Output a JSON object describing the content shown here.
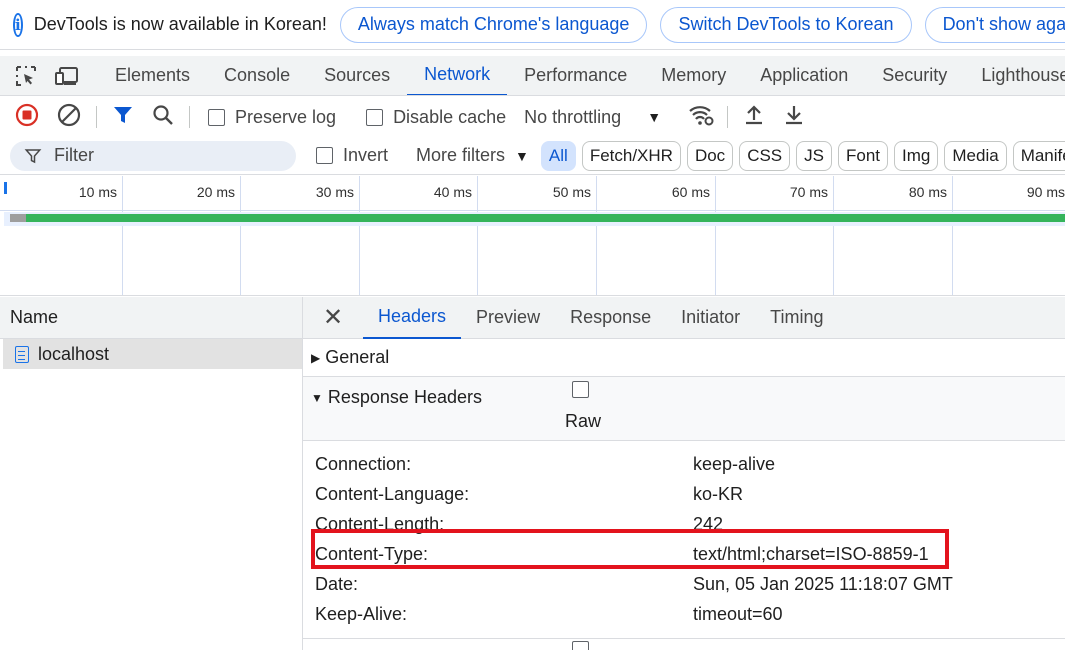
{
  "infobar": {
    "message": "DevTools is now available in Korean!",
    "btn_match": "Always match Chrome's language",
    "btn_switch": "Switch DevTools to Korean",
    "btn_dont_show": "Don't show again"
  },
  "main_tabs": [
    "Elements",
    "Console",
    "Sources",
    "Network",
    "Performance",
    "Memory",
    "Application",
    "Security",
    "Lighthouse"
  ],
  "active_main_tab": "Network",
  "toolbar": {
    "preserve_log": "Preserve log",
    "disable_cache": "Disable cache",
    "throttling": "No throttling"
  },
  "filterbar": {
    "filter_placeholder": "Filter",
    "invert": "Invert",
    "more_filters": "More filters",
    "chips": [
      "All",
      "Fetch/XHR",
      "Doc",
      "CSS",
      "JS",
      "Font",
      "Img",
      "Media",
      "Manifest"
    ],
    "active_chip": "All"
  },
  "timeline": {
    "ticks": [
      "10 ms",
      "20 ms",
      "30 ms",
      "40 ms",
      "50 ms",
      "60 ms",
      "70 ms",
      "80 ms",
      "90 ms"
    ]
  },
  "requests": {
    "column_name": "Name",
    "items": [
      {
        "name": "localhost"
      }
    ]
  },
  "details": {
    "tabs": [
      "Headers",
      "Preview",
      "Response",
      "Initiator",
      "Timing"
    ],
    "active_tab": "Headers",
    "general_label": "General",
    "response_headers_label": "Response Headers",
    "raw_label": "Raw",
    "response_headers": [
      {
        "name": "Connection:",
        "value": "keep-alive"
      },
      {
        "name": "Content-Language:",
        "value": "ko-KR"
      },
      {
        "name": "Content-Length:",
        "value": "242"
      },
      {
        "name": "Content-Type:",
        "value": "text/html;charset=ISO-8859-1"
      },
      {
        "name": "Date:",
        "value": "Sun, 05 Jan 2025 11:18:07 GMT"
      },
      {
        "name": "Keep-Alive:",
        "value": "timeout=60"
      }
    ]
  },
  "colors": {
    "accent": "#0b57d0",
    "highlight": "#e3131d",
    "timeline_bar": "#35b45b"
  }
}
